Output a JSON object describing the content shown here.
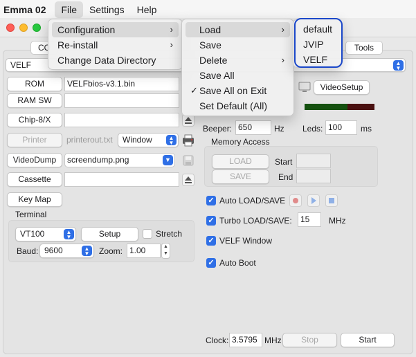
{
  "menubar": {
    "app": "Emma 02",
    "items": [
      "File",
      "Settings",
      "Help"
    ]
  },
  "file_menu": {
    "items": [
      {
        "label": "Configuration",
        "submenu": true
      },
      {
        "label": "Re-install",
        "submenu": true
      },
      {
        "label": "Change Data Directory",
        "submenu": false
      }
    ]
  },
  "config_menu": {
    "items": [
      {
        "label": "Load",
        "submenu": true
      },
      {
        "label": "Save",
        "submenu": false
      },
      {
        "label": "Delete",
        "submenu": true
      },
      {
        "label": "Save All",
        "submenu": false
      },
      {
        "label": "Save All on Exit",
        "checked": true
      },
      {
        "label": "Set Default (All)",
        "submenu": false
      }
    ]
  },
  "load_menu": {
    "items": [
      "default",
      "JVIP",
      "VELF"
    ]
  },
  "tabs": {
    "left_partial": "CO",
    "tools": "Tools"
  },
  "machine": {
    "selected": "VELF"
  },
  "left": {
    "rom_button": "ROM",
    "rom_file": "VELFbios-v3.1.bin",
    "ramsw_button": "RAM SW",
    "ramsw_file": "",
    "chip8_button": "Chip-8/X",
    "chip8_file": "",
    "printer_button": "Printer",
    "printer_file": "printerout.txt",
    "printer_mode": "Window",
    "videodump_button": "VideoDump",
    "videodump_file": "screendump.png",
    "cassette_button": "Cassette",
    "cassette_file": "",
    "keymap_button": "Key Map"
  },
  "terminal": {
    "title": "Terminal",
    "type": "VT100",
    "setup_button": "Setup",
    "stretch_label": "Stretch",
    "stretch_checked": false,
    "baud_label": "Baud:",
    "baud": "9600",
    "zoom_label": "Zoom:",
    "zoom": "1.00"
  },
  "right": {
    "videosetup_button": "VideoSetup",
    "beeper_label": "Beeper:",
    "beeper_value": "650",
    "beeper_unit": "Hz",
    "leds_label": "Leds:",
    "leds_value": "100",
    "leds_unit": "ms",
    "memory_access_title": "Memory Access",
    "load_button": "LOAD",
    "save_button": "SAVE",
    "start_label": "Start",
    "end_label": "End",
    "start_value": "",
    "end_value": "",
    "auto_load_save": "Auto LOAD/SAVE",
    "turbo_load_save": "Turbo LOAD/SAVE:",
    "turbo_value": "15",
    "turbo_unit": "MHz",
    "velf_window": "VELF Window",
    "auto_boot": "Auto Boot",
    "clock_label": "Clock:",
    "clock_value": "3.5795",
    "clock_unit": "MHz",
    "stop_button": "Stop",
    "start_button": "Start"
  },
  "colors": {
    "accent": "#2f6fe6",
    "highlight_ring": "#1a47c9",
    "led_green": "#14500f",
    "led_red": "#4a1010"
  }
}
